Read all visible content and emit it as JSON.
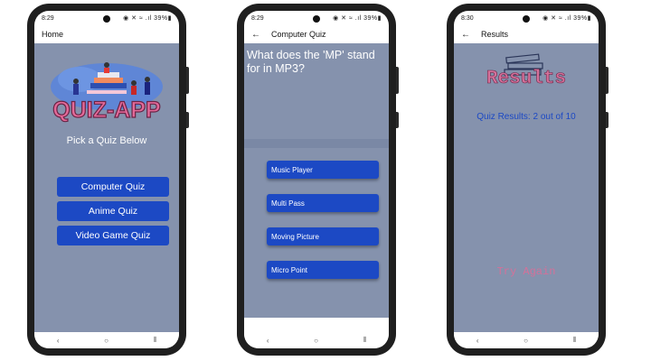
{
  "colors": {
    "content_bg": "#8592ad",
    "button": "#1c49c4",
    "results_title": "#d4719a",
    "results_text": "#1c49c4"
  },
  "phones": [
    {
      "status_time": "8:29",
      "status_right": "◉ ✕ ≈ .ıl 39%▮",
      "title": "Home",
      "has_back": false,
      "logo_text": "QUIZ-APP",
      "subtitle": "Pick a Quiz Below",
      "buttons": [
        "Computer Quiz",
        "Anime Quiz",
        "Video Game Quiz"
      ]
    },
    {
      "status_time": "8:29",
      "status_right": "◉ ✕ ≈ .ıl 39%▮",
      "title": "Computer Quiz",
      "has_back": true,
      "question": "What does the 'MP' stand for in MP3?",
      "answers": [
        "Music Player",
        "Multi Pass",
        "Moving Picture",
        "Micro Point"
      ]
    },
    {
      "status_time": "8:30",
      "status_right": "◉ ✕ ≈ .ıl 39%▮",
      "title": "Results",
      "has_back": true,
      "results_title": "Results",
      "score_text": "Quiz Results: 2 out of 10",
      "try_again": "Try Again"
    }
  ],
  "nav": {
    "back": "‹",
    "home": "○",
    "recents": "⦀"
  }
}
